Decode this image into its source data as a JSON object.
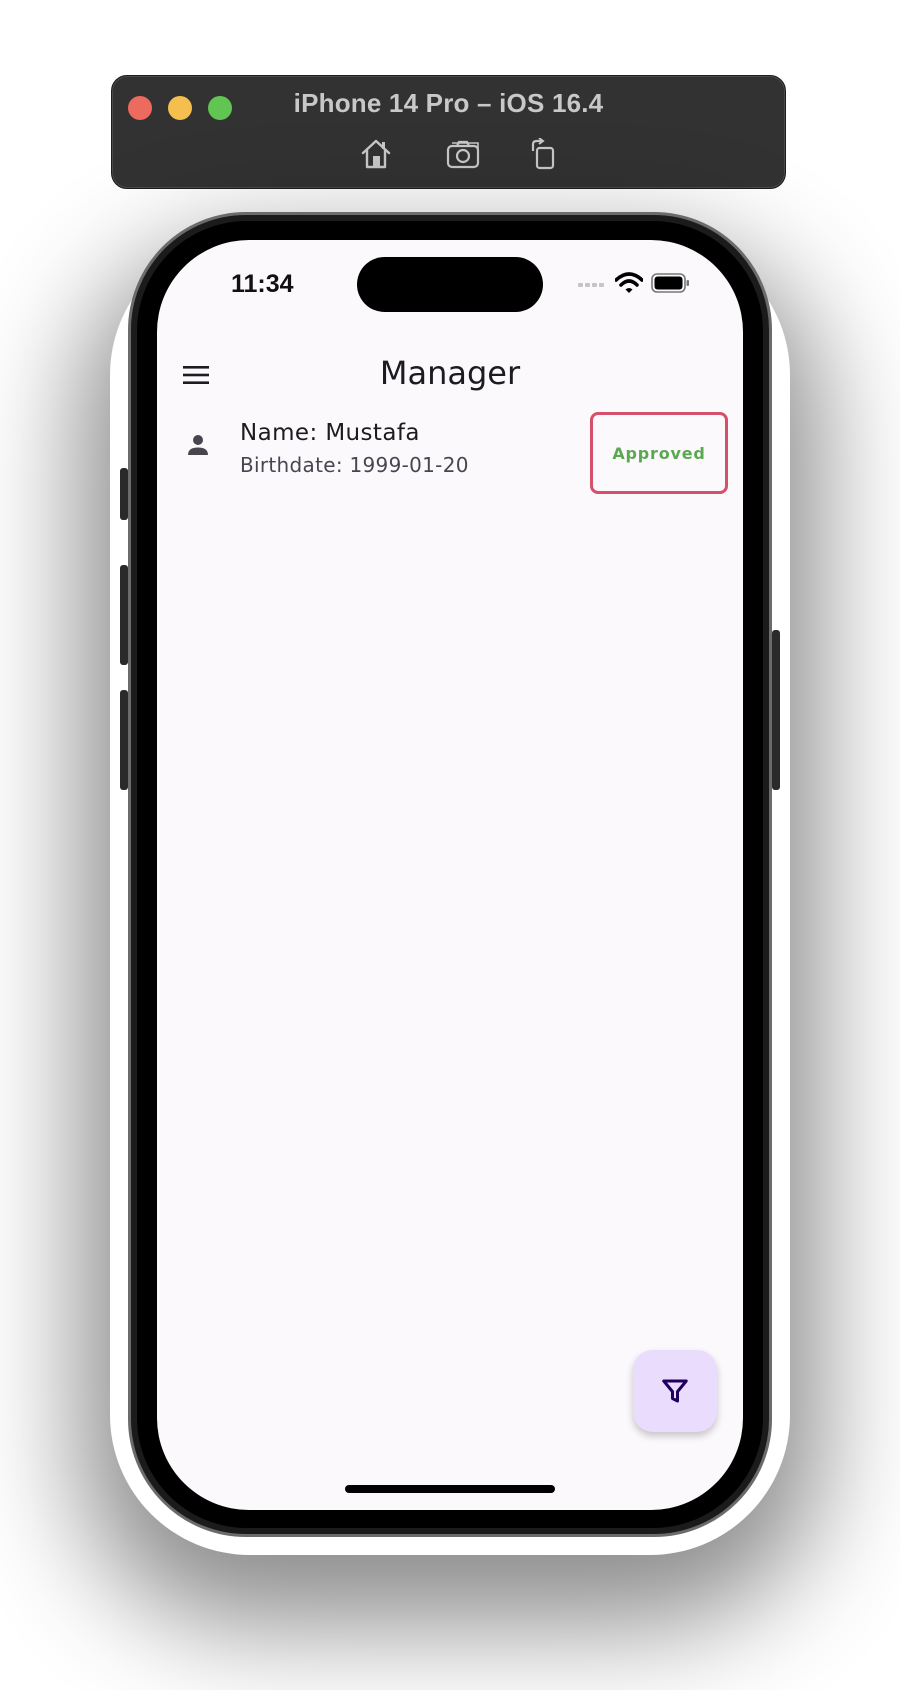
{
  "simulator": {
    "title": "iPhone 14 Pro – iOS 16.4",
    "toolbar": [
      "home-icon",
      "screenshot-icon",
      "rotate-icon"
    ]
  },
  "status_bar": {
    "time": "11:34",
    "icons": [
      "cellular-icon",
      "wifi-icon",
      "battery-icon"
    ]
  },
  "app_bar": {
    "title": "Manager",
    "leading_icon": "menu-icon"
  },
  "list": [
    {
      "name": "Name: Mustafa",
      "subtitle": "Birthdate: 1999-01-20",
      "status": "Approved",
      "icon": "person-icon"
    }
  ],
  "fab": {
    "icon": "filter-icon"
  },
  "colors": {
    "screen_bg": "#fcf9fd",
    "badge_border": "#d5506a",
    "approved_text": "#5aa84f",
    "fab_bg": "#eadcfd",
    "fab_icon": "#21005d"
  }
}
